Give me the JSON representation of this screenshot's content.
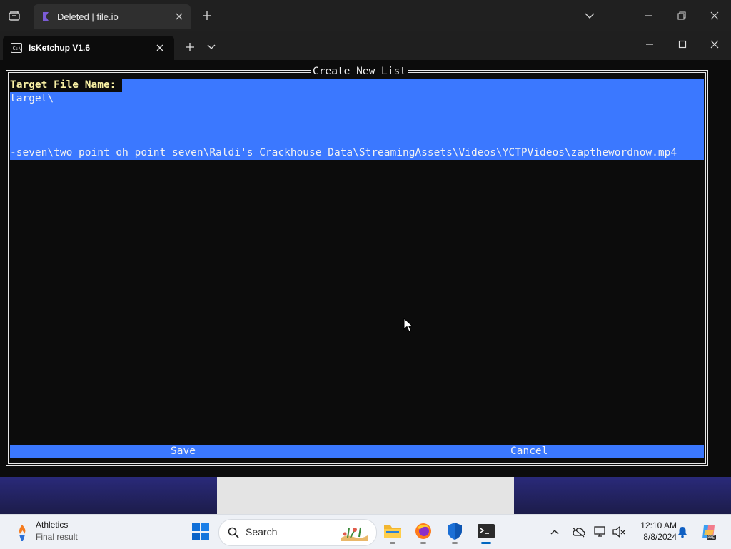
{
  "browser": {
    "tab_title": "Deleted | file.io"
  },
  "terminal": {
    "tab_title": "IsKetchup V1.6"
  },
  "dialog": {
    "title": "Create New List",
    "label": "Target File Name: ",
    "lines": [
      "target\\",
      "",
      "",
      "",
      "-seven\\two point oh point seven\\Raldi's Crackhouse_Data\\StreamingAssets\\Videos\\YCTPVideos\\zapthewordnow.mp4"
    ],
    "save_label": "Save",
    "cancel_label": "Cancel"
  },
  "taskbar": {
    "weather_title": "Athletics",
    "weather_subtitle": "Final result",
    "search_placeholder": "Search",
    "time": "12:10 AM",
    "date": "8/8/2024",
    "apps": [
      "file-explorer-icon",
      "firefox-icon",
      "windows-security-icon",
      "terminal-icon"
    ]
  },
  "colors": {
    "terminal_bg": "#0c0c0c",
    "selection_blue": "#3b78ff",
    "label_yellow": "#f9f1a5",
    "text_white": "#f2f2f2",
    "taskbar_bg": "#eef1f6"
  }
}
